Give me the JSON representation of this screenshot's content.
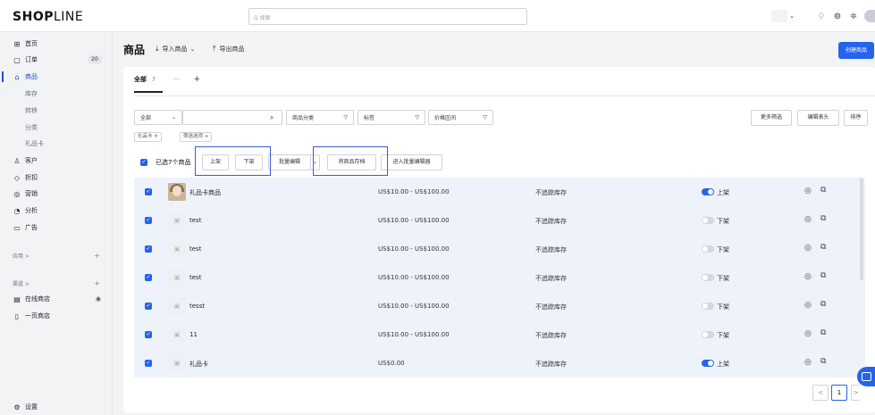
{
  "logo": {
    "bold": "SH",
    "o": "O",
    "p": "P",
    "thin": "LINE"
  },
  "search": {
    "placeholder": "Q 搜索"
  },
  "header_icons": [
    "chevron-down-icon",
    "bell-icon",
    "help-icon",
    "wifi-icon"
  ],
  "sidebar": {
    "items": [
      {
        "icon": "⊞",
        "label": "首页"
      },
      {
        "icon": "▢",
        "label": "订单",
        "badge": "20"
      },
      {
        "icon": "⌂",
        "label": "商品",
        "active": true
      },
      {
        "label": "库存",
        "sub": true
      },
      {
        "label": "转移",
        "sub": true
      },
      {
        "label": "分类",
        "sub": true
      },
      {
        "label": "礼品卡",
        "sub": true
      },
      {
        "icon": "♙",
        "label": "客户"
      },
      {
        "icon": "◇",
        "label": "折扣"
      },
      {
        "icon": "◎",
        "label": "营销"
      },
      {
        "icon": "◔",
        "label": "分析"
      },
      {
        "icon": "▭",
        "label": "广告"
      }
    ],
    "apps_label": "应用 >",
    "channels_label": "渠道 >",
    "channels": [
      {
        "icon": "▤",
        "label": "在线商店"
      },
      {
        "icon": "▯",
        "label": "一页商店"
      }
    ],
    "settings_label": "设置"
  },
  "page": {
    "title": "商品",
    "import_label": "导入商品",
    "export_label": "导出商品",
    "create_label": "创建商品"
  },
  "tabs": {
    "all_label": "全部",
    "all_count": "7",
    "more": "···",
    "add": "+"
  },
  "filters": {
    "status_value": "全部",
    "category_label": "商品分类",
    "tag_label": "标签",
    "price_label": "价格区间",
    "more_filters": "更多筛选",
    "edit_columns": "编辑表头",
    "sort": "排序"
  },
  "chips": [
    "礼品卡 ✕",
    "筛选选项 +"
  ],
  "bulk": {
    "selected_text": "已选7个商品",
    "publish": "上架",
    "unpublish": "下架",
    "bulk_edit": "批量编辑",
    "archive": "将商品存档",
    "bulk_editor": "进入批量编辑器"
  },
  "products": [
    {
      "name": "礼品卡商品",
      "price": "US$10.00 - US$100.00",
      "stock": "不追踪库存",
      "status": "上架",
      "on": true,
      "photo": true
    },
    {
      "name": "test",
      "price": "US$10.00 - US$100.00",
      "stock": "不追踪库存",
      "status": "下架",
      "on": false
    },
    {
      "name": "test",
      "price": "US$10.00 - US$100.00",
      "stock": "不追踪库存",
      "status": "下架",
      "on": false
    },
    {
      "name": "test",
      "price": "US$10.00 - US$100.00",
      "stock": "不追踪库存",
      "status": "下架",
      "on": false
    },
    {
      "name": "tesst",
      "price": "US$10.00 - US$100.00",
      "stock": "不追踪库存",
      "status": "下架",
      "on": false
    },
    {
      "name": "11",
      "price": "US$10.00 - US$100.00",
      "stock": "不追踪库存",
      "status": "下架",
      "on": false
    },
    {
      "name": "礼品卡",
      "price": "US$0.00",
      "stock": "不追踪库存",
      "status": "上架",
      "on": true
    }
  ],
  "pagination": {
    "prev": "<",
    "current": "1",
    "next": ">"
  }
}
